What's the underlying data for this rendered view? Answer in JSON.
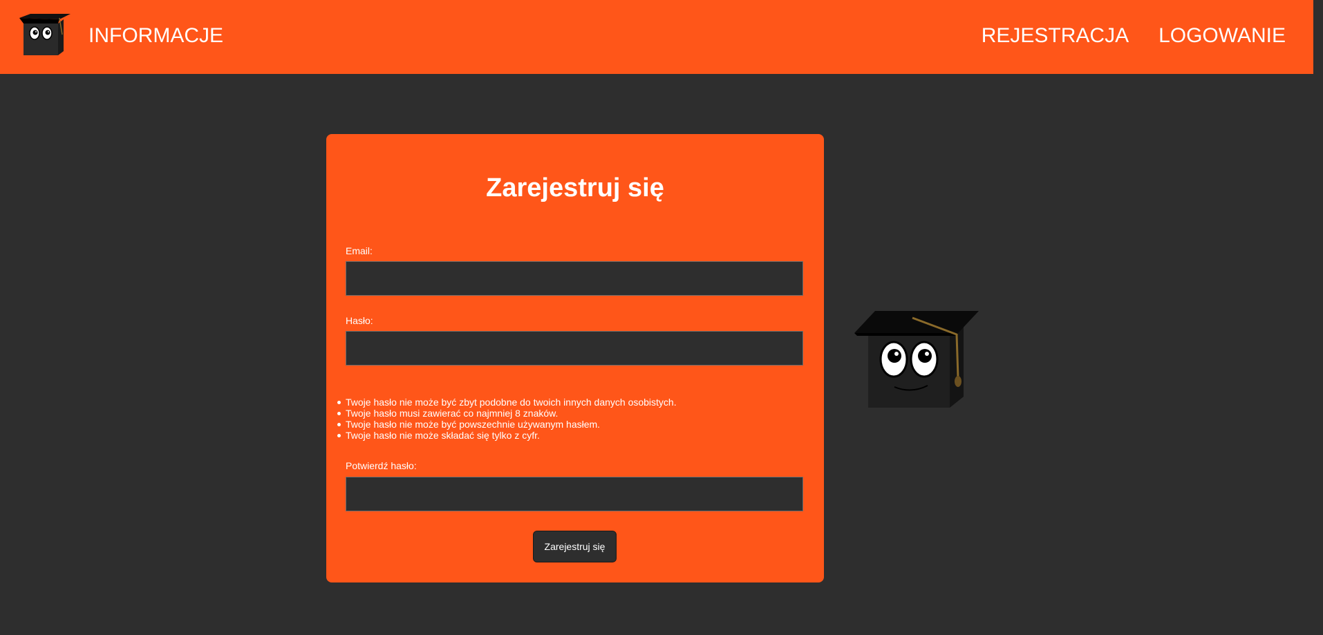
{
  "navbar": {
    "logo_icon": "owl-graduation-cap-mascot-icon",
    "info_link": "INFORMACJE",
    "register_link": "REJESTRACJA",
    "login_link": "LOGOWANIE"
  },
  "form": {
    "title": "Zarejestruj się",
    "email_label": "Email:",
    "email_value": "",
    "password_label": "Hasło:",
    "password_value": "",
    "password_rules": [
      "Twoje hasło nie może być zbyt podobne do twoich innych danych osobistych.",
      "Twoje hasło musi zawierać co najmniej 8 znaków.",
      "Twoje hasło nie może być powszechnie używanym hasłem.",
      "Twoje hasło nie może składać się tylko z cyfr."
    ],
    "confirm_label": "Potwierdź hasło:",
    "confirm_value": "",
    "submit_label": "Zarejestruj się"
  },
  "mascot": {
    "icon": "graduation-cap-cube-mascot-icon"
  },
  "colors": {
    "accent": "#ff5619",
    "background": "#2e2e2e",
    "text": "#ffffff"
  }
}
